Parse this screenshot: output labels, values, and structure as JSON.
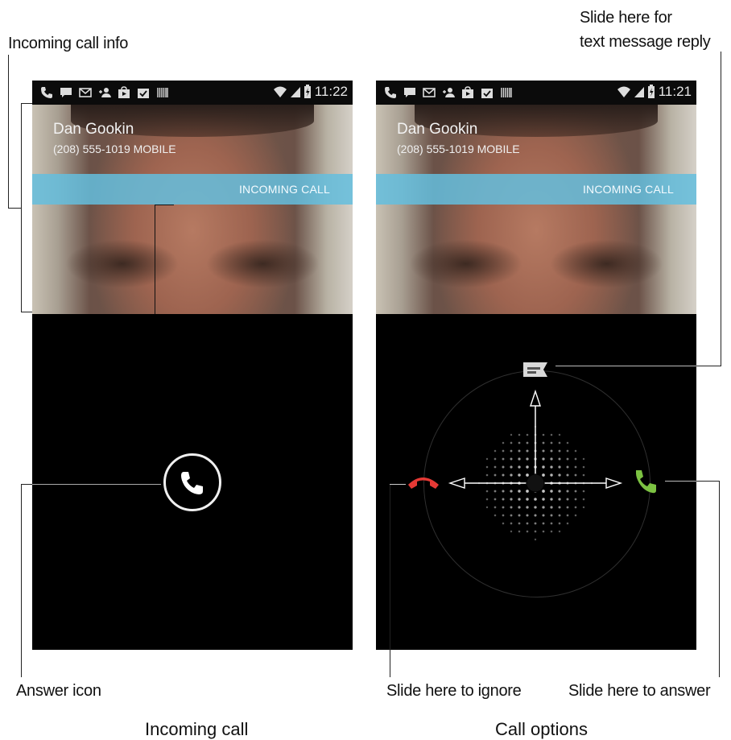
{
  "callouts": {
    "incoming_call_info": "Incoming call info",
    "slide_text_line1": "Slide here for",
    "slide_text_line2": "text message reply",
    "answer_icon": "Answer icon",
    "slide_ignore": "Slide here to ignore",
    "slide_answer": "Slide here to answer"
  },
  "captions": {
    "left": "Incoming call",
    "right": "Call options"
  },
  "left_phone": {
    "clock": "11:22",
    "caller_name": "Dan Gookin",
    "caller_number": "(208) 555-1019  MOBILE",
    "banner": "INCOMING CALL",
    "status_icons": [
      "phone-icon",
      "chat-icon",
      "mail-icon",
      "contact-add-icon",
      "play-store-icon",
      "task-check-icon",
      "barcode-icon"
    ]
  },
  "right_phone": {
    "clock": "11:21",
    "caller_name": "Dan Gookin",
    "caller_number": "(208) 555-1019  MOBILE",
    "banner": "INCOMING CALL",
    "status_icons": [
      "phone-icon",
      "chat-icon",
      "mail-icon",
      "contact-add-icon",
      "play-store-icon",
      "task-check-icon",
      "barcode-icon"
    ]
  },
  "colors": {
    "banner": "#64bede",
    "decline": "#e53935",
    "answer": "#7cc242"
  }
}
